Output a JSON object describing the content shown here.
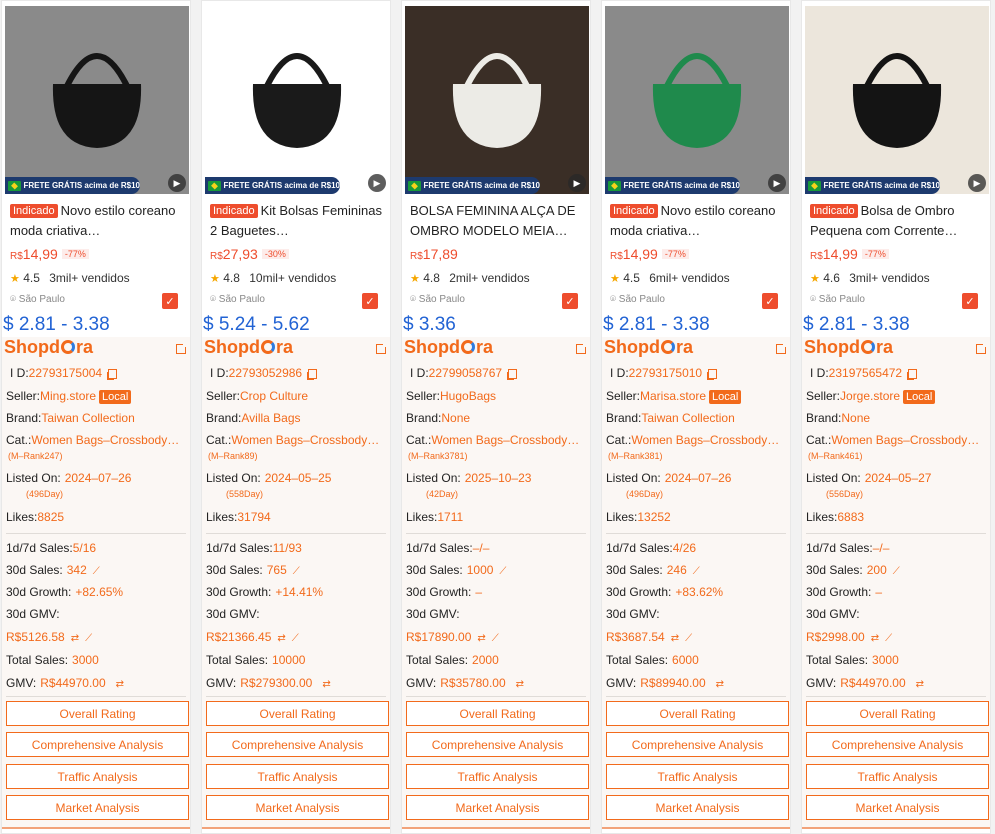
{
  "products": [
    {
      "frete": "FRETE GRÁTIS acima de R$10",
      "tag": "Indicado",
      "title": "Novo estilo coreano moda criativa…",
      "currency": "R$",
      "price": "14,99",
      "discount": "-77%",
      "rating": "4.5",
      "sold": "3mil+ vendidos",
      "location": "São Paulo",
      "usd": "$ 2.81 - 3.38",
      "id": "22793175004",
      "seller": "Ming.store",
      "local": "Local",
      "brand": "Taiwan Collection",
      "category": "Women Bags–Crossbody…",
      "rank": "(M–Rank247)",
      "listed_on": "2024–07–26",
      "listed_days": "(496Day)",
      "likes": "8825",
      "sales_1d7d": "5/16",
      "sales_30d": "342",
      "growth_30d": "+82.65%",
      "gmv_30d": "R$5126.58",
      "total_sales": "3000",
      "gmv": "R$44970.00",
      "photo_bg": "#8a8a8a",
      "bag_color": "#151515"
    },
    {
      "frete": "FRETE GRÁTIS acima de R$10",
      "tag": "Indicado",
      "title": "Kit Bolsas Femininas 2 Baguetes…",
      "currency": "R$",
      "price": "27,93",
      "discount": "-30%",
      "rating": "4.8",
      "sold": "10mil+ vendidos",
      "location": "São Paulo",
      "usd": "$ 5.24 - 5.62",
      "id": "22793052986",
      "seller": "Crop Culture",
      "local": "",
      "brand": "Avilla Bags",
      "category": "Women Bags–Crossbody…",
      "rank": "(M–Rank89)",
      "listed_on": "2024–05–25",
      "listed_days": "(558Day)",
      "likes": "31794",
      "sales_1d7d": "11/93",
      "sales_30d": "765",
      "growth_30d": "+14.41%",
      "gmv_30d": "R$21366.45",
      "total_sales": "10000",
      "gmv": "R$279300.00",
      "photo_bg": "#ffffff",
      "bag_color": "#1a1a1a"
    },
    {
      "frete": "FRETE GRÁTIS acima de R$10",
      "tag": "",
      "title": "BOLSA FEMININA ALÇA DE OMBRO MODELO MEIA…",
      "currency": "R$",
      "price": "17,89",
      "discount": "",
      "rating": "4.8",
      "sold": "2mil+ vendidos",
      "location": "São Paulo",
      "usd": "$ 3.36",
      "id": "22799058767",
      "seller": "HugoBags",
      "local": "",
      "brand": "None",
      "category": "Women Bags–Crossbody…",
      "rank": "(M–Rank3781)",
      "listed_on": "2025–10–23",
      "listed_days": "(42Day)",
      "likes": "1711",
      "sales_1d7d": "–/–",
      "sales_30d": "1000",
      "growth_30d": "–",
      "gmv_30d": "R$17890.00",
      "total_sales": "2000",
      "gmv": "R$35780.00",
      "photo_bg": "#3a2e26",
      "bag_color": "#ecebe6"
    },
    {
      "frete": "FRETE GRÁTIS acima de R$10",
      "tag": "Indicado",
      "title": "Novo estilo coreano moda criativa…",
      "currency": "R$",
      "price": "14,99",
      "discount": "-77%",
      "rating": "4.5",
      "sold": "6mil+ vendidos",
      "location": "São Paulo",
      "usd": "$ 2.81 - 3.38",
      "id": "22793175010",
      "seller": "Marisa.store",
      "local": "Local",
      "brand": "Taiwan Collection",
      "category": "Women Bags–Crossbody…",
      "rank": "(M–Rank381)",
      "listed_on": "2024–07–26",
      "listed_days": "(496Day)",
      "likes": "13252",
      "sales_1d7d": "4/26",
      "sales_30d": "246",
      "growth_30d": "+83.62%",
      "gmv_30d": "R$3687.54",
      "total_sales": "6000",
      "gmv": "R$89940.00",
      "photo_bg": "#8a8a8a",
      "bag_color": "#1f8a4c"
    },
    {
      "frete": "FRETE GRÁTIS acima de R$10",
      "tag": "Indicado",
      "title": "Bolsa de Ombro Pequena com Corrente…",
      "currency": "R$",
      "price": "14,99",
      "discount": "-77%",
      "rating": "4.6",
      "sold": "3mil+ vendidos",
      "location": "São Paulo",
      "usd": "$ 2.81 - 3.38",
      "id": "23197565472",
      "seller": "Jorge.store",
      "local": "Local",
      "brand": "None",
      "category": "Women Bags–Crossbody…",
      "rank": "(M–Rank461)",
      "listed_on": "2024–05–27",
      "listed_days": "(556Day)",
      "likes": "6883",
      "sales_1d7d": "–/–",
      "sales_30d": "200",
      "growth_30d": "–",
      "gmv_30d": "R$2998.00",
      "total_sales": "3000",
      "gmv": "R$44970.00",
      "photo_bg": "#ece6dc",
      "bag_color": "#141414"
    }
  ],
  "labels": {
    "logo_a": "Shopd",
    "logo_b": "ra",
    "id": "I D:",
    "seller": "Seller:",
    "brand": "Brand:",
    "category": "Cat.:",
    "listed_on": "Listed On:",
    "likes": "Likes:",
    "sales_1d7d": "1d/7d Sales:",
    "sales_30d": "30d Sales:",
    "growth_30d": "30d Growth:",
    "gmv_30d": "30d GMV:",
    "total_sales": "Total Sales:",
    "gmv": "GMV:",
    "btn_overall": "Overall Rating",
    "btn_comprehensive": "Comprehensive Analysis",
    "btn_traffic": "Traffic Analysis",
    "btn_market": "Market Analysis"
  },
  "colors": {
    "accent": "#f26a1b",
    "shopee": "#ee4d2d",
    "usd": "#2263d4"
  }
}
